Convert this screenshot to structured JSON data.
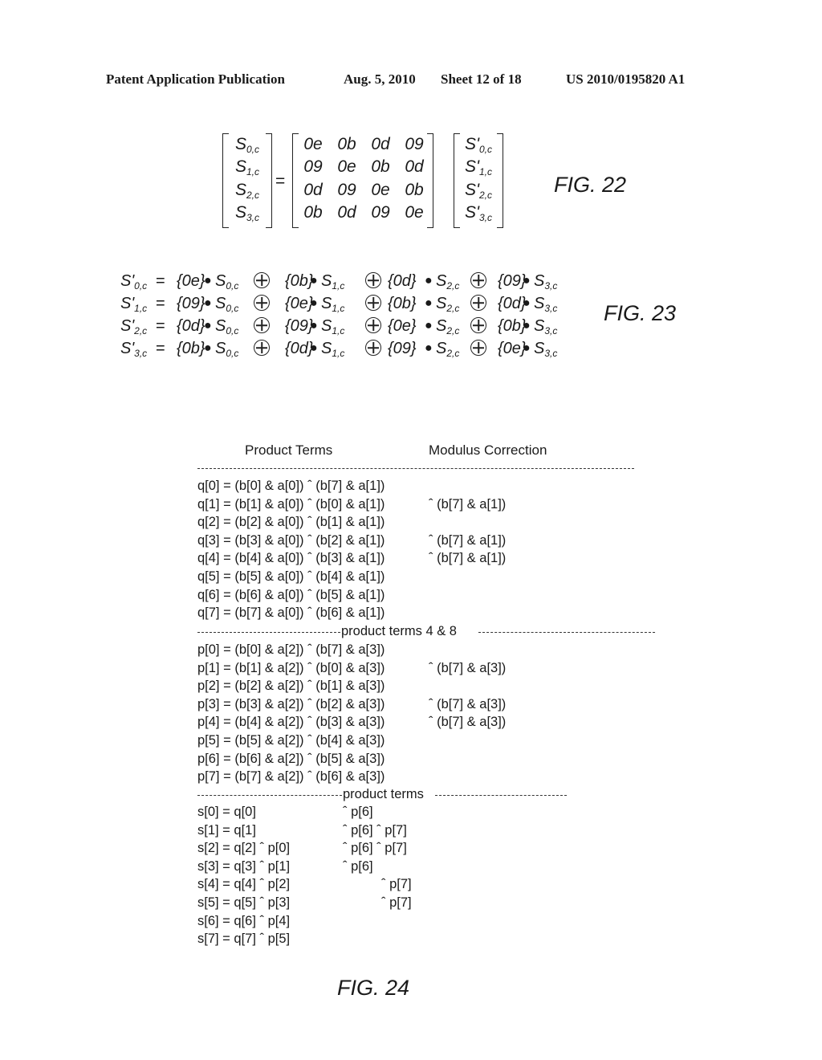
{
  "header": {
    "publication": "Patent Application Publication",
    "date": "Aug. 5, 2010",
    "sheet": "Sheet 12 of 18",
    "number": "US 2010/0195820 A1"
  },
  "fig22": {
    "label": "FIG. 22",
    "equals": "=",
    "lhs": [
      {
        "base": "S",
        "sub": "0,c"
      },
      {
        "base": "S",
        "sub": "1,c"
      },
      {
        "base": "S",
        "sub": "2,c"
      },
      {
        "base": "S",
        "sub": "3,c"
      }
    ],
    "matrix": [
      [
        "0e",
        "0b",
        "0d",
        "09"
      ],
      [
        "09",
        "0e",
        "0b",
        "0d"
      ],
      [
        "0d",
        "09",
        "0e",
        "0b"
      ],
      [
        "0b",
        "0d",
        "09",
        "0e"
      ]
    ],
    "rhs": [
      {
        "base": "S'",
        "sub": "0,c"
      },
      {
        "base": "S'",
        "sub": "1,c"
      },
      {
        "base": "S'",
        "sub": "2,c"
      },
      {
        "base": "S'",
        "sub": "3,c"
      }
    ]
  },
  "fig23": {
    "label": "FIG. 23",
    "equations": [
      {
        "lhs": {
          "base": "S'",
          "sub": "0,c"
        },
        "coeffs": [
          "{0e}",
          "{0b}",
          "{0d}",
          "{09}"
        ]
      },
      {
        "lhs": {
          "base": "S'",
          "sub": "1,c"
        },
        "coeffs": [
          "{09}",
          "{0e}",
          "{0b}",
          "{0d}"
        ]
      },
      {
        "lhs": {
          "base": "S'",
          "sub": "2,c"
        },
        "coeffs": [
          "{0d}",
          "{09}",
          "{0e}",
          "{0b}"
        ]
      },
      {
        "lhs": {
          "base": "S'",
          "sub": "3,c"
        },
        "coeffs": [
          "{0b}",
          "{0d}",
          "{09}",
          "{0e}"
        ]
      }
    ],
    "terms": [
      {
        "base": "S",
        "sub": "0,c"
      },
      {
        "base": "S",
        "sub": "1,c"
      },
      {
        "base": "S",
        "sub": "2,c"
      },
      {
        "base": "S",
        "sub": "3,c"
      }
    ],
    "equals": "=",
    "dot": "●"
  },
  "fig24": {
    "label": "FIG. 24",
    "col_product": "Product Terms",
    "col_modulus": "Modulus Correction",
    "sep_product_4_8": "product terms 4 & 8",
    "sep_product": "product terms",
    "q_rows": [
      {
        "term": "q[0] = (b[0] & a[0]) ˆ (b[7] & a[1])",
        "correction": ""
      },
      {
        "term": "q[1] = (b[1] & a[0]) ˆ (b[0] & a[1])",
        "correction": "ˆ (b[7] & a[1])"
      },
      {
        "term": "q[2] = (b[2] & a[0]) ˆ (b[1] & a[1])",
        "correction": ""
      },
      {
        "term": "q[3] = (b[3] & a[0]) ˆ (b[2] & a[1])",
        "correction": "ˆ (b[7] & a[1])"
      },
      {
        "term": "q[4] = (b[4] & a[0]) ˆ (b[3] & a[1])",
        "correction": "ˆ (b[7] & a[1])"
      },
      {
        "term": "q[5] = (b[5] & a[0]) ˆ (b[4] & a[1])",
        "correction": ""
      },
      {
        "term": "q[6] = (b[6] & a[0]) ˆ (b[5] & a[1])",
        "correction": ""
      },
      {
        "term": "q[7] = (b[7] & a[0]) ˆ (b[6] & a[1])",
        "correction": ""
      }
    ],
    "p_rows": [
      {
        "term": "p[0] = (b[0] & a[2]) ˆ (b[7] & a[3])",
        "correction": ""
      },
      {
        "term": "p[1] = (b[1] & a[2]) ˆ (b[0] & a[3])",
        "correction": "ˆ (b[7] & a[3])"
      },
      {
        "term": "p[2] = (b[2] & a[2]) ˆ (b[1] & a[3])",
        "correction": ""
      },
      {
        "term": "p[3] = (b[3] & a[2]) ˆ (b[2] & a[3])",
        "correction": "ˆ (b[7] & a[3])"
      },
      {
        "term": "p[4] = (b[4] & a[2]) ˆ (b[3] & a[3])",
        "correction": "ˆ (b[7] & a[3])"
      },
      {
        "term": "p[5] = (b[5] & a[2]) ˆ (b[4] & a[3])",
        "correction": ""
      },
      {
        "term": "p[6] = (b[6] & a[2]) ˆ (b[5] & a[3])",
        "correction": ""
      },
      {
        "term": "p[7] = (b[7] & a[2]) ˆ (b[6] & a[3])",
        "correction": ""
      }
    ],
    "s_rows": [
      {
        "term": "s[0] = q[0]",
        "p6": "ˆ p[6]",
        "p7": ""
      },
      {
        "term": "s[1] = q[1]",
        "p6": "ˆ p[6] ˆ p[7]",
        "p7": ""
      },
      {
        "term": "s[2] = q[2] ˆ p[0]",
        "p6": "ˆ p[6] ˆ p[7]",
        "p7": ""
      },
      {
        "term": "s[3] = q[3] ˆ p[1]",
        "p6": "ˆ p[6]",
        "p7": ""
      },
      {
        "term": "s[4] = q[4] ˆ p[2]",
        "p6": "",
        "p7": "ˆ p[7]"
      },
      {
        "term": "s[5] = q[5] ˆ p[3]",
        "p6": "",
        "p7": "ˆ p[7]"
      },
      {
        "term": "s[6] = q[6] ˆ p[4]",
        "p6": "",
        "p7": ""
      },
      {
        "term": "s[7] = q[7] ˆ p[5]",
        "p6": "",
        "p7": ""
      }
    ]
  }
}
